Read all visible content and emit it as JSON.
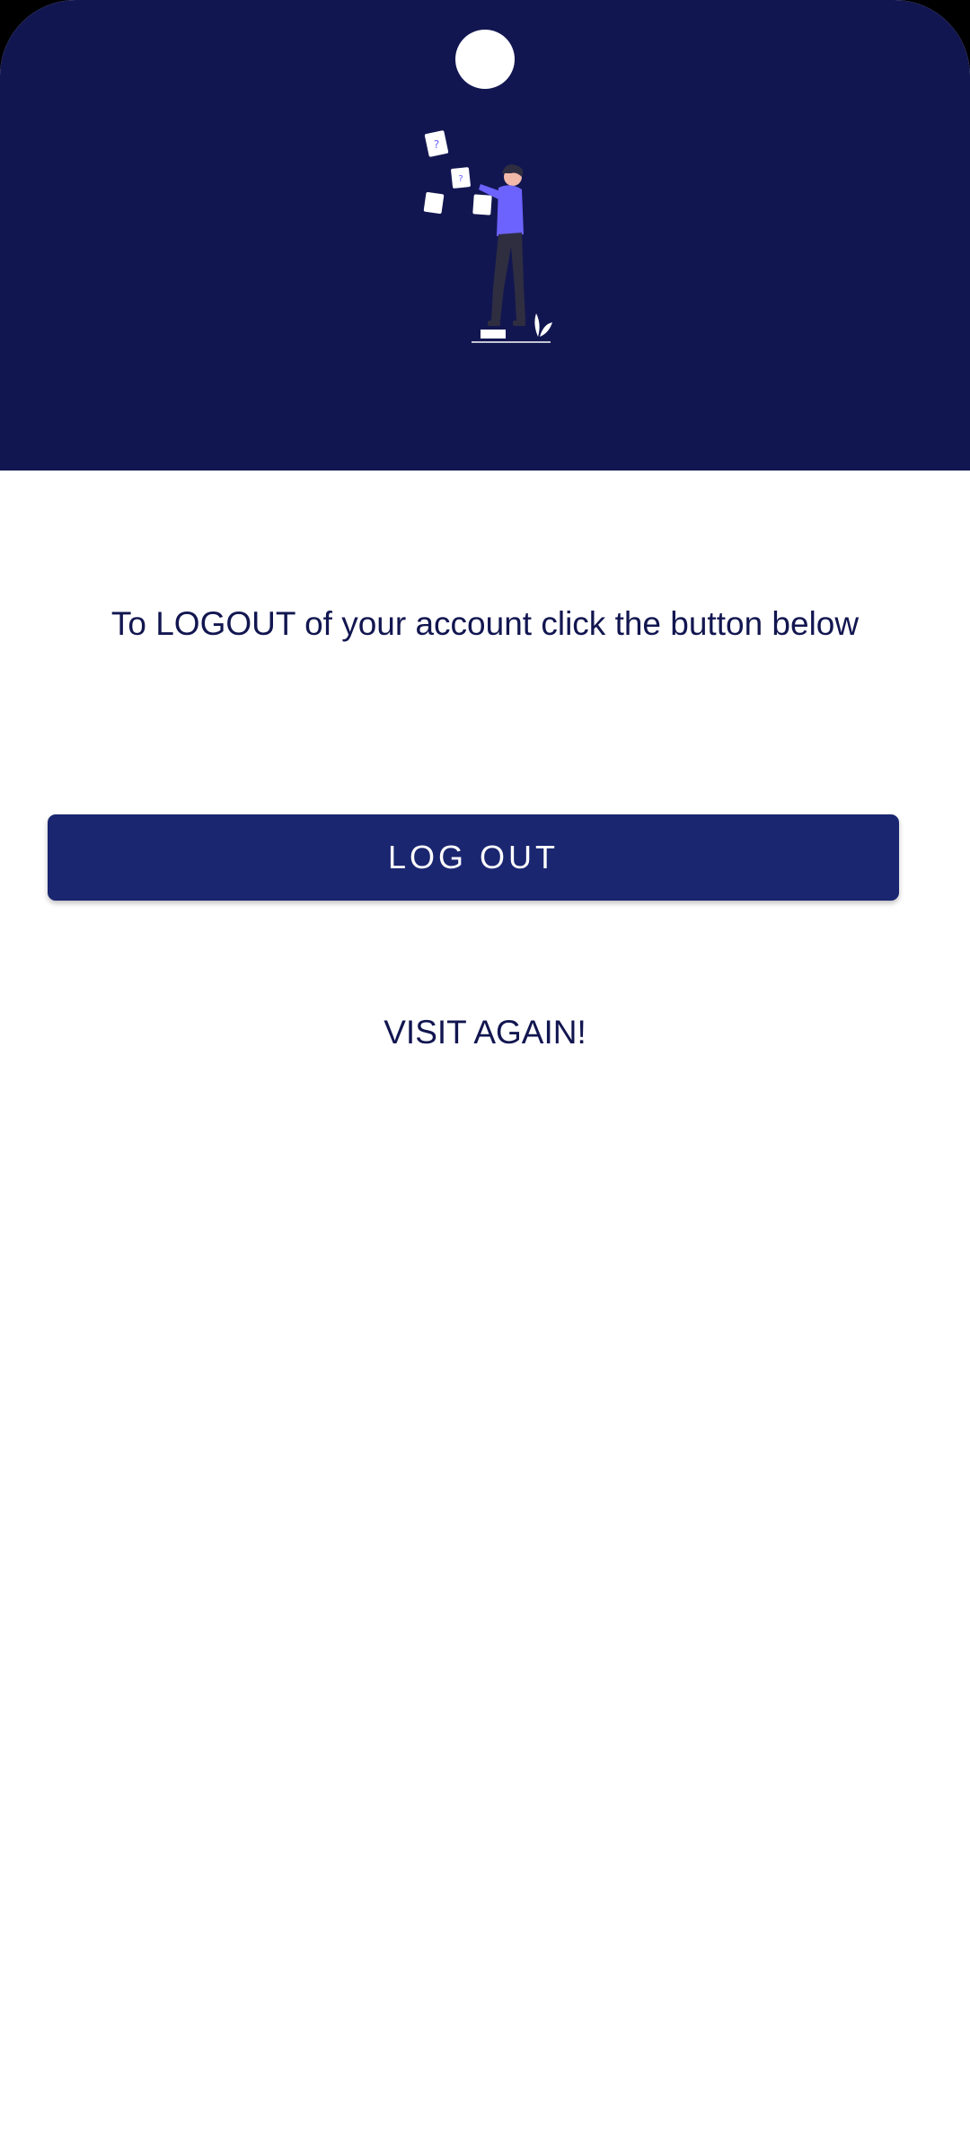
{
  "header": {
    "illustration": "person-sticking-notes-illustration",
    "background_color": "#121650"
  },
  "main": {
    "message": "To LOGOUT of your account click the button below",
    "logout_label": "LOG OUT",
    "farewell": "VISIT AGAIN!"
  },
  "colors": {
    "primary_dark": "#121650",
    "button": "#1a2670",
    "accent": "#6c63ff"
  }
}
